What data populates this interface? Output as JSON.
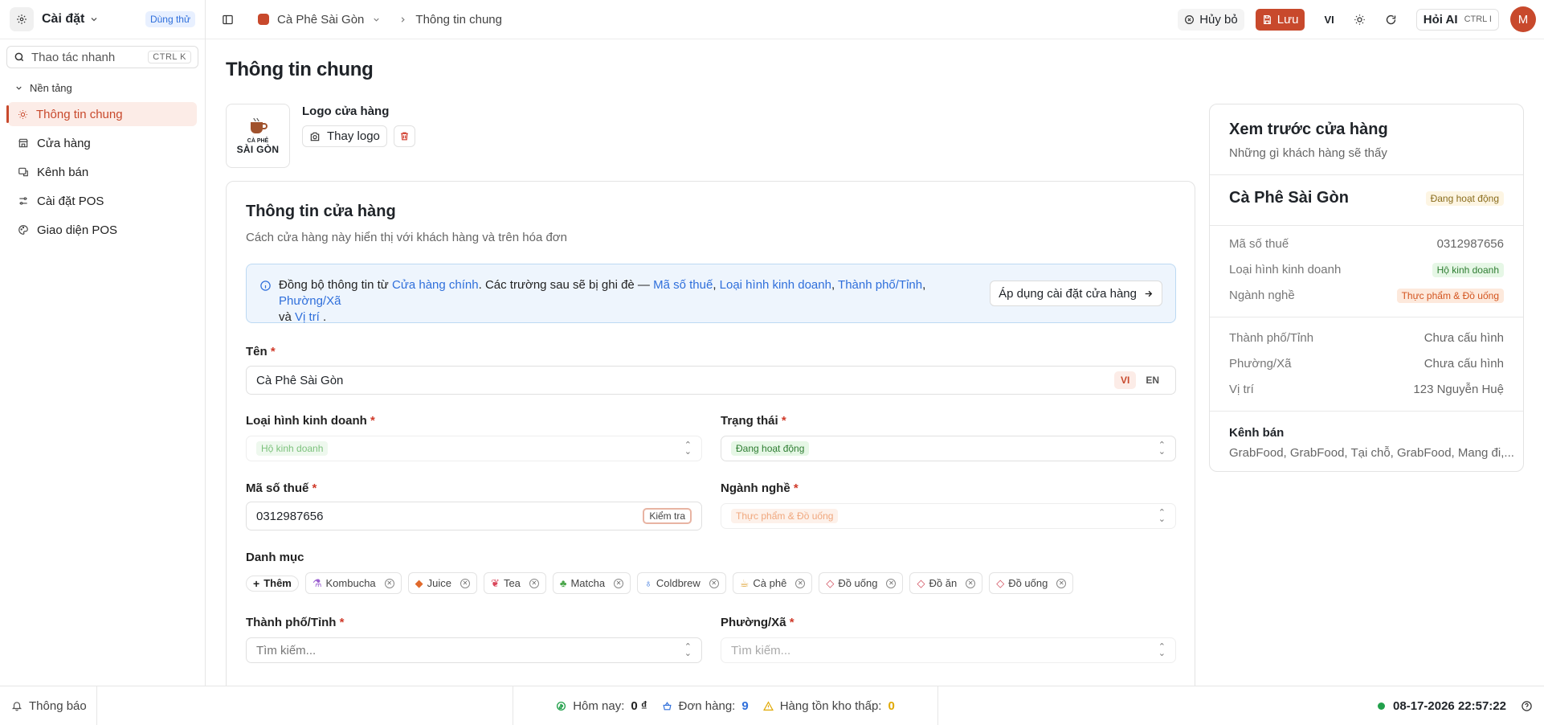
{
  "sidebar": {
    "title": "Cài đặt",
    "trial_badge": "Dùng thử",
    "search_placeholder": "Thao tác nhanh",
    "search_shortcut": "CTRL K",
    "group_label": "Nền tảng",
    "items": [
      {
        "label": "Thông tin chung",
        "icon": "sun-icon",
        "active": true
      },
      {
        "label": "Cửa hàng",
        "icon": "store-icon"
      },
      {
        "label": "Kênh bán",
        "icon": "channel-icon"
      },
      {
        "label": "Cài đặt POS",
        "icon": "sliders-icon"
      },
      {
        "label": "Giao diện POS",
        "icon": "palette-icon"
      }
    ]
  },
  "topbar": {
    "store_name": "Cà Phê Sài Gòn",
    "page": "Thông tin chung",
    "cancel_label": "Hủy bỏ",
    "save_label": "Lưu",
    "lang": "VI",
    "ai_label": "Hỏi AI",
    "ai_shortcut": "CTRL I",
    "avatar_initial": "M"
  },
  "main": {
    "page_title": "Thông tin chung",
    "logo": {
      "label": "Logo cửa hàng",
      "change_label": "Thay logo",
      "logo_line1": "CÀ PHÊ",
      "logo_line2": "SÀI GÒN"
    },
    "card": {
      "title": "Thông tin cửa hàng",
      "subtitle": "Cách cửa hàng này hiển thị với khách hàng và trên hóa đơn",
      "info": {
        "t1": "Đồng bộ thông tin từ ",
        "l1": "Cửa hàng chính",
        "t2": ". Các trường sau sẽ bị ghi đè — ",
        "l2": "Mã số thuế",
        "t3": ", ",
        "l3": "Loại hình kinh doanh",
        "t4": ", ",
        "l4": "Thành phố/Tỉnh",
        "t5": ", ",
        "l5": "Phường/Xã",
        "t6": " và ",
        "l6": "Vị trí",
        "t7": " .",
        "apply_label": "Áp dụng cài đặt cửa hàng"
      },
      "name_label": "Tên",
      "name_value": "Cà Phê Sài Gòn",
      "lang_vi": "VI",
      "lang_en": "EN",
      "biz_type_label": "Loại hình kinh doanh",
      "biz_type_value": "Hộ kinh doanh",
      "status_label": "Trạng thái",
      "status_value": "Đang hoạt động",
      "tax_label": "Mã số thuế",
      "tax_value": "0312987656",
      "check_label": "Kiểm tra",
      "industry_label": "Ngành nghề",
      "industry_value": "Thực phẩm & Đồ uống",
      "category_label": "Danh mục",
      "add_label": "Thêm",
      "categories": [
        {
          "label": "Kombucha",
          "icon": "flask-icon",
          "color": "#9b5fd0"
        },
        {
          "label": "Juice",
          "icon": "juice-icon",
          "color": "#e0692b"
        },
        {
          "label": "Tea",
          "icon": "leaf-icon",
          "color": "#d9465a"
        },
        {
          "label": "Matcha",
          "icon": "sprout-icon",
          "color": "#4aa64a"
        },
        {
          "label": "Coldbrew",
          "icon": "coldbrew-icon",
          "color": "#2f6fdb"
        },
        {
          "label": "Cà phê",
          "icon": "coffee-icon",
          "color": "#e0a63b"
        },
        {
          "label": "Đồ uống",
          "icon": "tag-icon",
          "color": "#d04a5a"
        },
        {
          "label": "Đồ ăn",
          "icon": "tag-icon",
          "color": "#d04a5a"
        },
        {
          "label": "Đồ uống",
          "icon": "tag-icon",
          "color": "#d04a5a"
        }
      ],
      "city_label": "Thành phố/Tỉnh",
      "city_placeholder": "Tìm kiếm...",
      "ward_label": "Phường/Xã",
      "ward_placeholder": "Tìm kiếm..."
    }
  },
  "preview": {
    "title": "Xem trước cửa hàng",
    "subtitle": "Những gì khách hàng sẽ thấy",
    "store_name": "Cà Phê Sài Gòn",
    "status_badge": "Đang hoạt động",
    "rows": [
      {
        "label": "Mã số thuế",
        "value": "0312987656"
      },
      {
        "label": "Loại hình kinh doanh",
        "value": "Hộ kinh doanh"
      },
      {
        "label": "Ngành nghề",
        "value": "Thực phẩm & Đồ uống"
      },
      {
        "label": "Thành phố/Tỉnh",
        "value": "Chưa cấu hình"
      },
      {
        "label": "Phường/Xã",
        "value": "Chưa cấu hình"
      },
      {
        "label": "Vị trí",
        "value": "123 Nguyễn Huệ"
      }
    ],
    "channels_title": "Kênh bán",
    "channels_value": "GrabFood, GrabFood, Tại chỗ, GrabFood, Mang đi,..."
  },
  "bottombar": {
    "notifications": "Thông báo",
    "today_label": "Hôm nay:",
    "today_value": "0 ₫",
    "orders_label": "Đơn hàng:",
    "orders_value": "9",
    "low_stock_label": "Hàng tồn kho thấp:",
    "low_stock_value": "0",
    "datetime": "08-17-2026 22:57:22"
  },
  "colors": {
    "accent": "#c8492c",
    "link": "#2f6fdb",
    "success": "#22a04b",
    "warning": "#e0a800"
  }
}
